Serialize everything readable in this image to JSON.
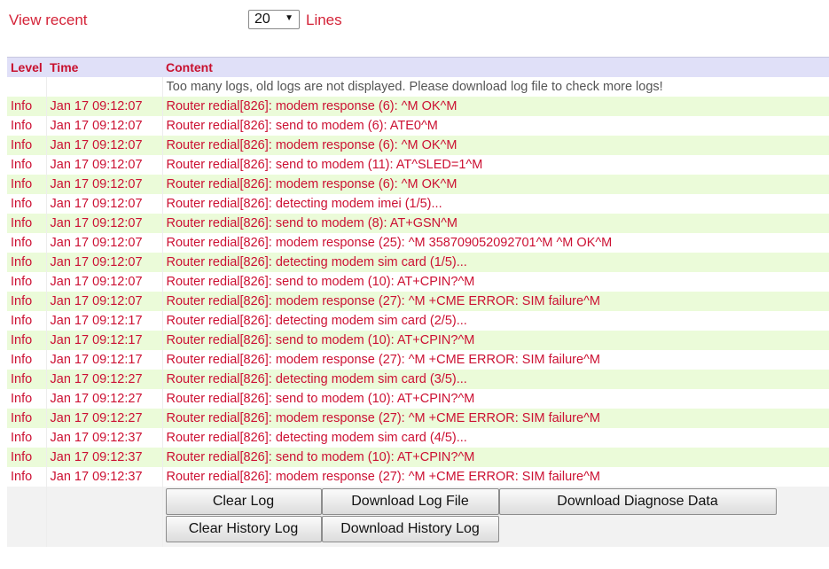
{
  "view": {
    "label": "View recent",
    "lines_value": "20",
    "lines_label": "Lines"
  },
  "table": {
    "headers": {
      "level": "Level",
      "time": "Time",
      "content": "Content"
    },
    "note": "Too many logs, old logs are not displayed. Please download log file to check more logs!",
    "rows": [
      {
        "level": "Info",
        "time": "Jan 17 09:12:07",
        "content": "Router redial[826]: modem response (6): ^M OK^M"
      },
      {
        "level": "Info",
        "time": "Jan 17 09:12:07",
        "content": "Router redial[826]: send to modem (6): ATE0^M"
      },
      {
        "level": "Info",
        "time": "Jan 17 09:12:07",
        "content": "Router redial[826]: modem response (6): ^M OK^M"
      },
      {
        "level": "Info",
        "time": "Jan 17 09:12:07",
        "content": "Router redial[826]: send to modem (11): AT^SLED=1^M"
      },
      {
        "level": "Info",
        "time": "Jan 17 09:12:07",
        "content": "Router redial[826]: modem response (6): ^M OK^M"
      },
      {
        "level": "Info",
        "time": "Jan 17 09:12:07",
        "content": "Router redial[826]: detecting modem imei (1/5)..."
      },
      {
        "level": "Info",
        "time": "Jan 17 09:12:07",
        "content": "Router redial[826]: send to modem (8): AT+GSN^M"
      },
      {
        "level": "Info",
        "time": "Jan 17 09:12:07",
        "content": "Router redial[826]: modem response (25): ^M 358709052092701^M ^M OK^M"
      },
      {
        "level": "Info",
        "time": "Jan 17 09:12:07",
        "content": "Router redial[826]: detecting modem sim card (1/5)..."
      },
      {
        "level": "Info",
        "time": "Jan 17 09:12:07",
        "content": "Router redial[826]: send to modem (10): AT+CPIN?^M"
      },
      {
        "level": "Info",
        "time": "Jan 17 09:12:07",
        "content": "Router redial[826]: modem response (27): ^M +CME ERROR: SIM failure^M"
      },
      {
        "level": "Info",
        "time": "Jan 17 09:12:17",
        "content": "Router redial[826]: detecting modem sim card (2/5)..."
      },
      {
        "level": "Info",
        "time": "Jan 17 09:12:17",
        "content": "Router redial[826]: send to modem (10): AT+CPIN?^M"
      },
      {
        "level": "Info",
        "time": "Jan 17 09:12:17",
        "content": "Router redial[826]: modem response (27): ^M +CME ERROR: SIM failure^M"
      },
      {
        "level": "Info",
        "time": "Jan 17 09:12:27",
        "content": "Router redial[826]: detecting modem sim card (3/5)..."
      },
      {
        "level": "Info",
        "time": "Jan 17 09:12:27",
        "content": "Router redial[826]: send to modem (10): AT+CPIN?^M"
      },
      {
        "level": "Info",
        "time": "Jan 17 09:12:27",
        "content": "Router redial[826]: modem response (27): ^M +CME ERROR: SIM failure^M"
      },
      {
        "level": "Info",
        "time": "Jan 17 09:12:37",
        "content": "Router redial[826]: detecting modem sim card (4/5)..."
      },
      {
        "level": "Info",
        "time": "Jan 17 09:12:37",
        "content": "Router redial[826]: send to modem (10): AT+CPIN?^M"
      },
      {
        "level": "Info",
        "time": "Jan 17 09:12:37",
        "content": "Router redial[826]: modem response (27): ^M +CME ERROR: SIM failure^M"
      }
    ]
  },
  "buttons": {
    "clear_log": "Clear Log",
    "download_log_file": "Download Log File",
    "download_diagnose_data": "Download Diagnose Data",
    "clear_history_log": "Clear History Log",
    "download_history_log": "Download History Log"
  },
  "colors": {
    "text_red": "#cc1133",
    "header_bg": "#e0e0f8",
    "row_green": "#ebfbd9"
  }
}
